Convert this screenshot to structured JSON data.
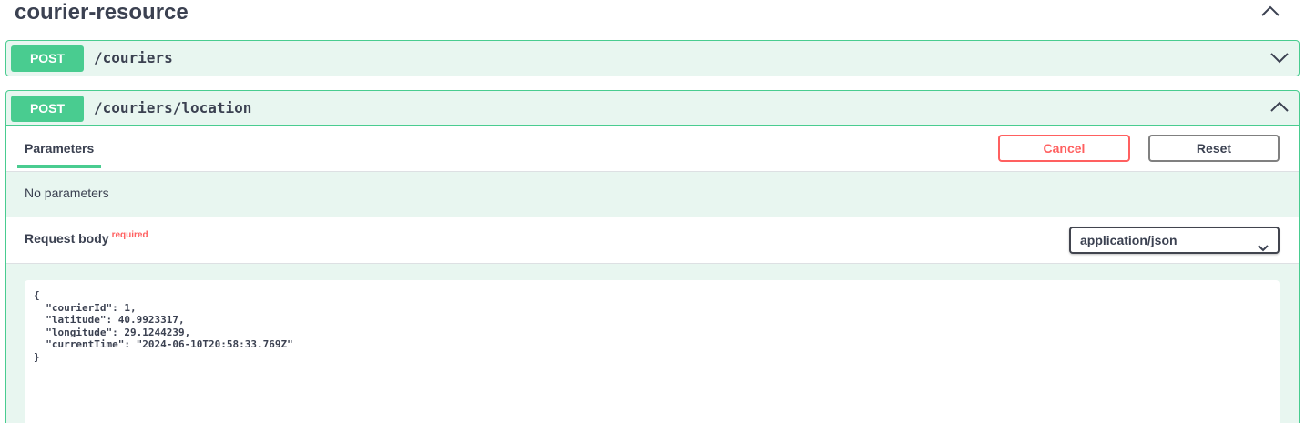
{
  "tag": {
    "title": "courier-resource",
    "expand_icon": "chevron-up-icon"
  },
  "operations": [
    {
      "method": "POST",
      "path": "/couriers",
      "chevron": "chevron-down-icon"
    },
    {
      "method": "POST",
      "path": "/couriers/location",
      "chevron": "chevron-up-icon"
    }
  ],
  "parameters": {
    "tab_label": "Parameters",
    "cancel_label": "Cancel",
    "reset_label": "Reset",
    "no_params": "No parameters"
  },
  "request_body": {
    "title": "Request body",
    "required_label": "required",
    "content_type": "application/json",
    "example": "{\n  \"courierId\": 1,\n  \"latitude\": 40.9923317,\n  \"longitude\": 29.1244239,\n  \"currentTime\": \"2024-06-10T20:58:33.769Z\"\n}"
  },
  "colors": {
    "post_green": "#49cc90",
    "post_bg": "#e8f6f0",
    "cancel_red": "#ff6060",
    "text": "#3b4151"
  }
}
